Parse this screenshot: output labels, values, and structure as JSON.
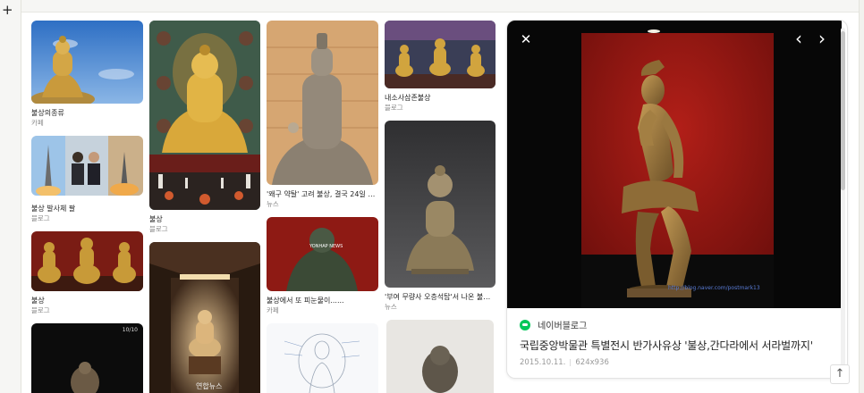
{
  "window": {
    "plus_glyph": "+"
  },
  "results": [
    {
      "id": "r1",
      "caption": "불상의종류",
      "source": "카페"
    },
    {
      "id": "r2",
      "caption": "불상 발사체 팔",
      "source": "블로그"
    },
    {
      "id": "r3",
      "caption": "불상",
      "source": "블로그"
    },
    {
      "id": "r4",
      "caption": "불상",
      "source": "블로그"
    },
    {
      "id": "r5",
      "caption": "'왜구 약탈' 고려 불상, 결국 24일 일...",
      "source": "뉴스"
    },
    {
      "id": "r6",
      "caption": "불상에서 또 피눈물이......",
      "source": "카페"
    },
    {
      "id": "r7",
      "caption": "내소사삼존불상",
      "source": "블로그"
    },
    {
      "id": "r8",
      "caption": "'부여 무량사 오층석탑'서 나온 불상 ...",
      "source": "뉴스"
    }
  ],
  "image_overlays": {
    "r6_watermark": "YONHAP NEWS",
    "r9_watermark": "연합뉴스",
    "r10_badge": "10/10"
  },
  "viewer": {
    "blog_name": "네이버블로그",
    "title": "국립중앙박물관 특별전시 반가사유상 '불상,간다라에서 서라벌까지'",
    "date": "2015.10.11.",
    "size": "624x936",
    "watermark": "http://blog.naver.com/postmark13",
    "close_glyph": "✕",
    "prev_glyph": "‹",
    "next_glyph": "›",
    "top_glyph": "↑"
  }
}
